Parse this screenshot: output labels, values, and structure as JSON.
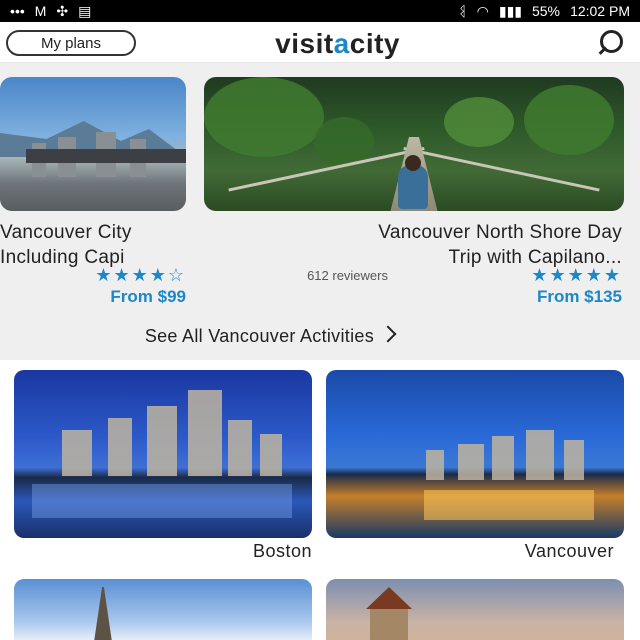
{
  "status_bar": {
    "time": "12:02 PM",
    "battery": "55%",
    "left_icons": [
      "signal-icon",
      "wifi-icon",
      "bluetooth-icon"
    ],
    "right_icons": [
      "more-dots-icon",
      "gmail-icon",
      "fan-icon",
      "sd-icon"
    ]
  },
  "header": {
    "logo": {
      "text_main": "visit",
      "text_accent": "a",
      "text_end": "city"
    },
    "my_plans_label": "My plans",
    "search_icon": "search-icon"
  },
  "activities": [
    {
      "title_line1": "Vancouver North Shore Day",
      "title_line2": "Trip with Capilano...",
      "stars": "★★★★★",
      "rating": 5,
      "reviews": "612 reviewers",
      "price": "From $135"
    },
    {
      "title_line1": "Vancouver City",
      "title_line2": "Including Capi",
      "stars": "★★★★☆",
      "rating": 4.5,
      "price": "From $99"
    }
  ],
  "see_all_label": "See All Vancouver Activities",
  "destinations": [
    {
      "name": "Vancouver"
    },
    {
      "name": "Boston"
    },
    {
      "name": ""
    },
    {
      "name": ""
    }
  ],
  "colors": {
    "accent": "#1c88c8",
    "strip_bg": "#efefef",
    "status_bg": "#000000"
  }
}
